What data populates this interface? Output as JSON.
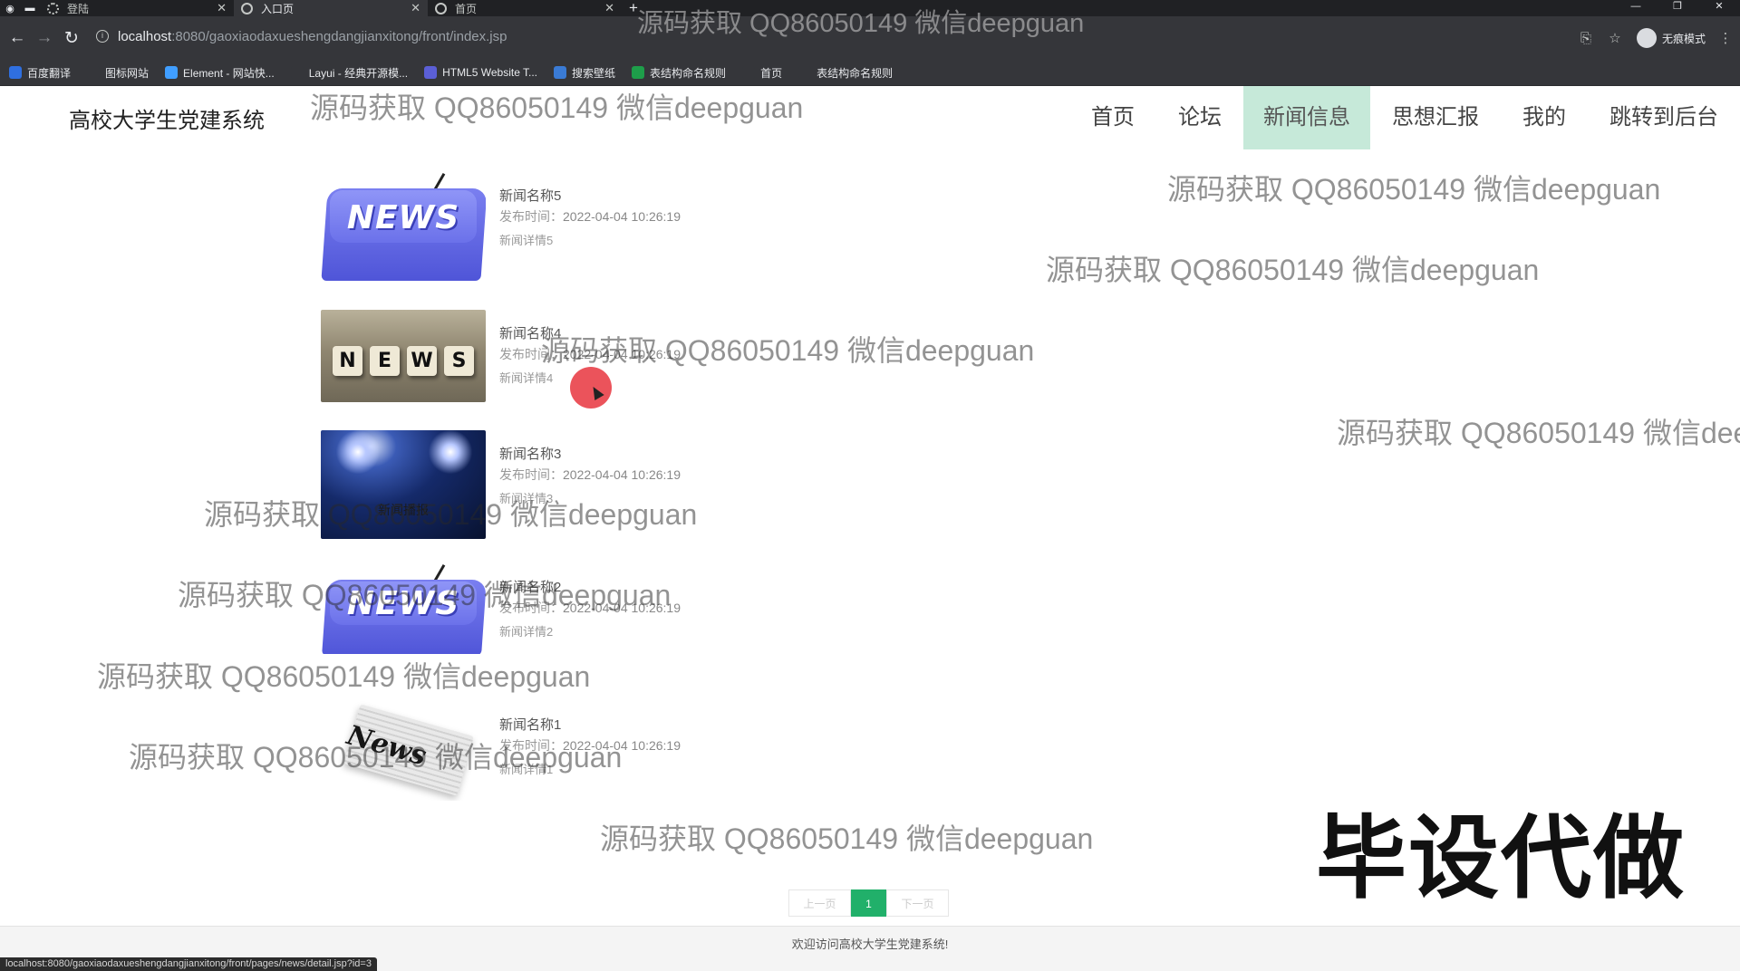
{
  "browser": {
    "tabs": [
      {
        "title": "登陆",
        "active": false
      },
      {
        "title": "入口页",
        "active": true
      },
      {
        "title": "首页",
        "active": false
      }
    ],
    "new_tab": "+",
    "url_host": "localhost",
    "url_path": ":8080/gaoxiaodaxueshengdangjianxitong/front/index.jsp",
    "profile_label": "无痕模式",
    "bookmarks": [
      {
        "label": "百度翻译",
        "icon": "translate-icon",
        "color": "#2f6fe0"
      },
      {
        "label": "图标网站",
        "icon": "flag-icon",
        "color": "#35363a"
      },
      {
        "label": "Element - 网站快...",
        "icon": "element-icon",
        "color": "#409eff"
      },
      {
        "label": "Layui - 经典开源模...",
        "icon": "layui-icon",
        "color": "#35363a"
      },
      {
        "label": "HTML5 Website T...",
        "icon": "html5-icon",
        "color": "#5b5fd6"
      },
      {
        "label": "搜索壁纸",
        "icon": "wallpaper-icon",
        "color": "#3a7bd5"
      },
      {
        "label": "表结构命名规则",
        "icon": "sheet-icon",
        "color": "#1e9e4a"
      },
      {
        "label": "首页",
        "icon": "globe-icon",
        "color": "#35363a"
      },
      {
        "label": "表结构命名规则",
        "icon": "globe-icon",
        "color": "#35363a"
      }
    ]
  },
  "site": {
    "title": "高校大学生党建系统",
    "nav": [
      {
        "label": "首页",
        "active": false
      },
      {
        "label": "论坛",
        "active": false
      },
      {
        "label": "新闻信息",
        "active": true
      },
      {
        "label": "思想汇报",
        "active": false
      },
      {
        "label": "我的",
        "active": false
      },
      {
        "label": "跳转到后台",
        "active": false
      }
    ],
    "active_color": "#c6e9d9"
  },
  "news": [
    {
      "title": "新闻名称5",
      "time_label": "发布时间：",
      "time": "2022-04-04 10:26:19",
      "detail": "新闻详情5",
      "image": "news-key-image"
    },
    {
      "title": "新闻名称4",
      "time_label": "发布时间：",
      "time": "2022-04-04 10:26:19",
      "detail": "新闻详情4",
      "image": "news-cubes-image"
    },
    {
      "title": "新闻名称3",
      "time_label": "发布时间：",
      "time": "2022-04-04 10:26:19",
      "detail": "新闻详情3",
      "image": "news-stage-image",
      "image_text": "新闻播报"
    },
    {
      "title": "新闻名称2",
      "time_label": "发布时间：",
      "time": "2022-04-04 10:26:19",
      "detail": "新闻详情2",
      "image": "news-key-image"
    },
    {
      "title": "新闻名称1",
      "time_label": "发布时间：",
      "time": "2022-04-04 10:26:19",
      "detail": "新闻详情1",
      "image": "news-paper-image"
    }
  ],
  "thumb_words": {
    "key": "NEWS",
    "cubes": [
      "N",
      "E",
      "W",
      "S"
    ],
    "paper": "News"
  },
  "pagination": {
    "prev": "上一页",
    "current": "1",
    "next": "下一页",
    "accent": "#21b06a"
  },
  "footer": "欢迎访问高校大学生党建系统!",
  "status_url": "localhost:8080/gaoxiaodaxueshengdangjianxitong/front/pages/news/detail.jsp?id=3",
  "watermark": "源码获取 QQ86050149 微信deepguan",
  "promo": "毕设代做"
}
